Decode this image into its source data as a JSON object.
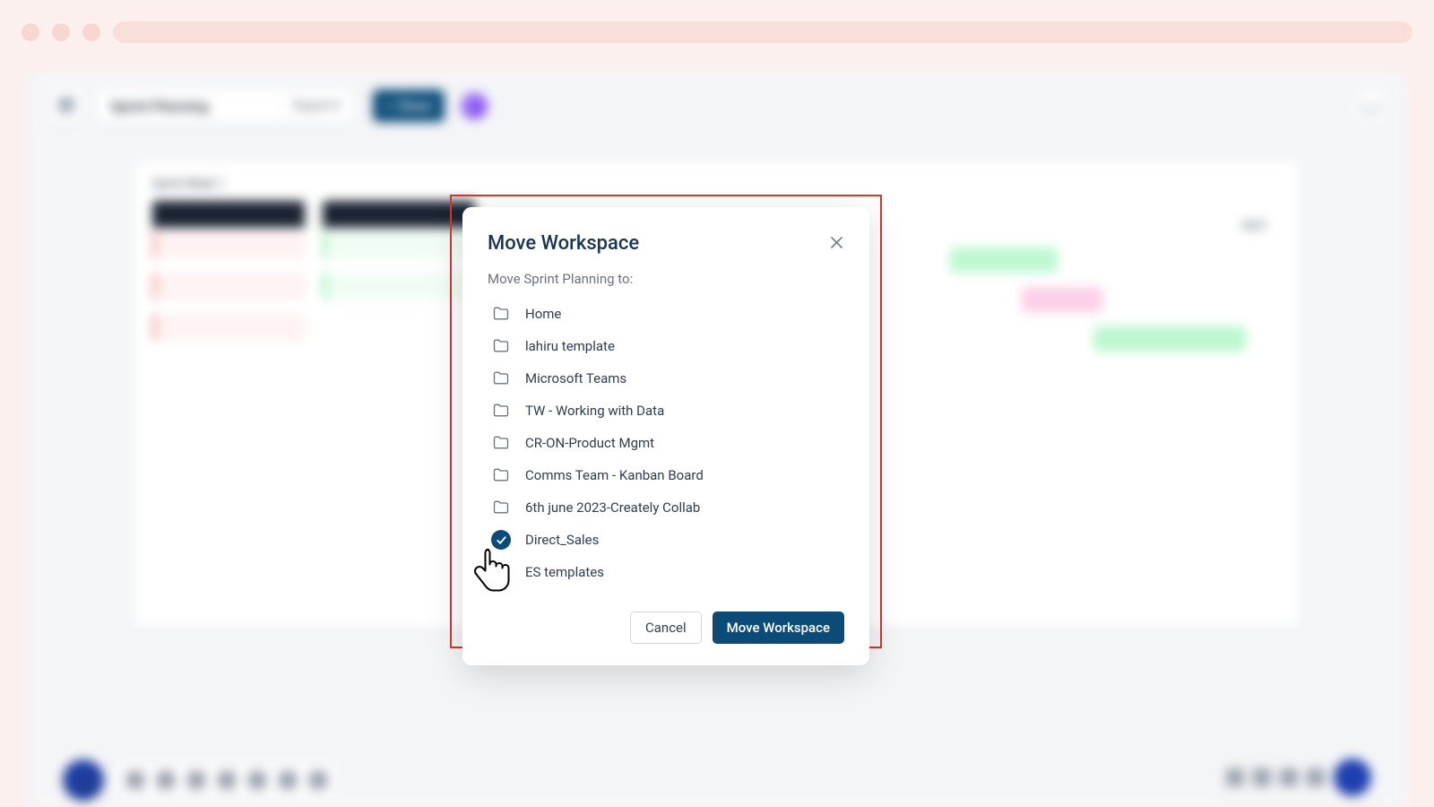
{
  "chrome": {},
  "app": {
    "title": "Sprint Planning",
    "export_label": "Export ▾",
    "share_label": "Share",
    "canvas_label": "Sprint Week 1",
    "gantt_label": "April"
  },
  "modal": {
    "title": "Move Workspace",
    "subtitle": "Move Sprint Planning to:",
    "folders": [
      {
        "label": "Home",
        "selected": false
      },
      {
        "label": "lahiru template",
        "selected": false
      },
      {
        "label": "Microsoft Teams",
        "selected": false
      },
      {
        "label": "TW - Working with Data",
        "selected": false
      },
      {
        "label": "CR-ON-Product Mgmt",
        "selected": false
      },
      {
        "label": "Comms Team - Kanban Board",
        "selected": false
      },
      {
        "label": "6th june 2023-Creately Collab",
        "selected": false
      },
      {
        "label": "Direct_Sales",
        "selected": true
      },
      {
        "label": "ES templates",
        "selected": false
      }
    ],
    "cancel_label": "Cancel",
    "confirm_label": "Move Workspace"
  }
}
